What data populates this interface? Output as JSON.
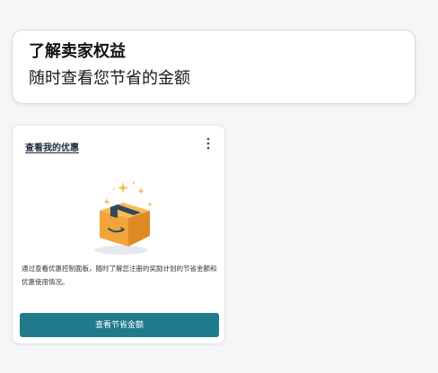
{
  "header": {
    "title": "了解卖家权益",
    "subtitle": "随时查看您节省的金额"
  },
  "widget": {
    "title": "查看我的优惠",
    "more_icon": "more-vertical-icon",
    "illustration_icon": "package-box-icon",
    "description": "通过查看优惠控制面板，随时了解您注册的奖励计划的节省金额和优惠使用情况。",
    "button_label": "查看节省金额"
  },
  "colors": {
    "page_background": "#f5f6f8",
    "button": "#1f7a8c",
    "box_orange": "#f2a33a",
    "box_tape": "#2f4a5c",
    "sparkle": "#f3c25a"
  }
}
